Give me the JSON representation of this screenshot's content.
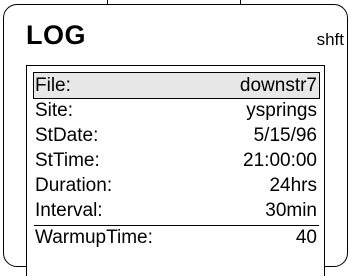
{
  "header": {
    "title": "LOG",
    "mode": "shft"
  },
  "params": [
    {
      "label": "File:",
      "value": "downstr7",
      "selected": true
    },
    {
      "label": "Site:",
      "value": "ysprings"
    },
    {
      "label": "StDate:",
      "value": "5/15/96"
    },
    {
      "label": "StTime:",
      "value": "21:00:00"
    },
    {
      "label": "Duration:",
      "value": "24hrs"
    },
    {
      "label": "Interval:",
      "value": "30min"
    },
    {
      "label": "WarmupTime:",
      "value": "40"
    }
  ],
  "colors": {
    "selection": "#e7e7e7",
    "ink": "#000000",
    "background": "#ffffff"
  }
}
